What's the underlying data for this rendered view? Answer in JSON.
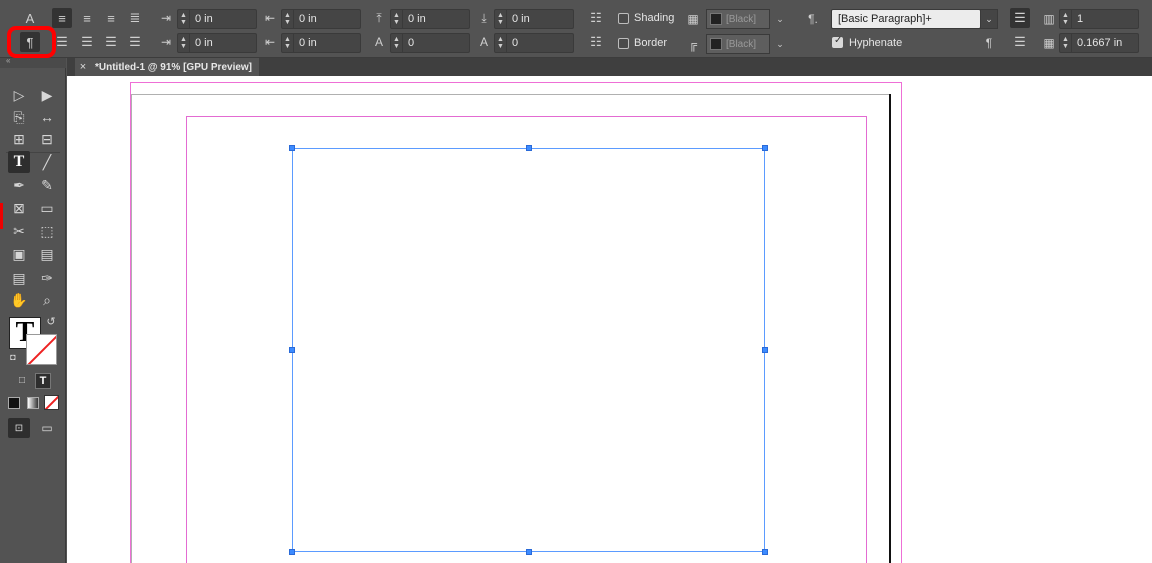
{
  "control_bar": {
    "row1": {
      "left_indent": "0 in",
      "right_indent": "0 in",
      "space_before": "0 in",
      "space_after": "0 in",
      "shading_label": "Shading",
      "shading_swatch": "[Black]",
      "paragraph_style": "[Basic Paragraph]+",
      "columns": "1"
    },
    "row2": {
      "first_line_indent": "0 in",
      "last_line_indent": "0 in",
      "drop_cap_lines": "0",
      "drop_cap_chars": "0",
      "border_label": "Border",
      "border_swatch": "[Black]",
      "hyphenate_label": "Hyphenate",
      "gutter": "0.1667 in"
    },
    "hyphenate_checked": true,
    "shading_checked": false,
    "border_checked": false,
    "icons": {
      "char_mode": "A",
      "para_mode": "¶",
      "style_mark": "¶."
    }
  },
  "tab": {
    "title": "*Untitled-1 @ 91% [GPU Preview]",
    "close": "×"
  },
  "tools": {
    "type_tool": "T",
    "fill_stroke_T": "T",
    "format_text_T": "T"
  },
  "colors": {
    "ui_bg": "#535353",
    "frame_blue": "#5b9bff",
    "margin_magenta": "#e36bd2",
    "highlight_red": "#ff0000"
  }
}
